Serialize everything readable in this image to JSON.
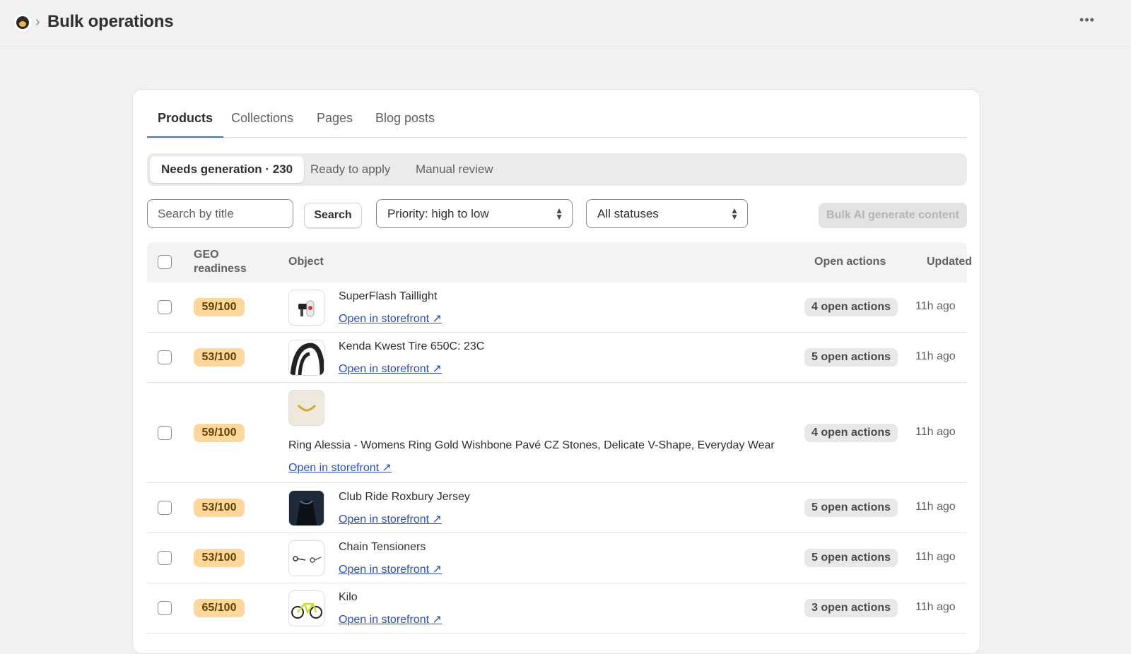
{
  "header": {
    "title": "Bulk operations",
    "breadcrumb_separator": "›",
    "more_label": "•••",
    "app_icon": "app-logo-icon"
  },
  "tabs": [
    {
      "label": "Products",
      "active": true
    },
    {
      "label": "Collections",
      "active": false
    },
    {
      "label": "Pages",
      "active": false
    },
    {
      "label": "Blog posts",
      "active": false
    }
  ],
  "segments": [
    {
      "label": "Needs generation · 230",
      "active": true
    },
    {
      "label": "Ready to apply",
      "active": false
    },
    {
      "label": "Manual review",
      "active": false
    }
  ],
  "filters": {
    "search_placeholder": "Search by title",
    "search_button": "Search",
    "sort_value": "Priority: high to low",
    "status_value": "All statuses",
    "bulk_button": "Bulk AI generate content",
    "bulk_disabled": true
  },
  "table": {
    "columns": {
      "geo_line1": "GEO",
      "geo_line2": "readiness",
      "object": "Object",
      "open_actions": "Open actions",
      "updated": "Updated"
    },
    "link_label": "Open in storefront ↗",
    "rows": [
      {
        "score": "59/100",
        "name": "SuperFlash Taillight",
        "actions": "4 open actions",
        "updated": "11h ago",
        "thumb": "taillight-thumb"
      },
      {
        "score": "53/100",
        "name": "Kenda Kwest Tire 650C: 23C",
        "actions": "5 open actions",
        "updated": "11h ago",
        "thumb": "tire-thumb"
      },
      {
        "score": "59/100",
        "name": "Ring Alessia - Womens Ring Gold Wishbone Pavé CZ Stones, Delicate V-Shape, Everyday Wear",
        "actions": "4 open actions",
        "updated": "11h ago",
        "thumb": "ring-thumb"
      },
      {
        "score": "53/100",
        "name": "Club Ride Roxbury Jersey",
        "actions": "5 open actions",
        "updated": "11h ago",
        "thumb": "jersey-thumb"
      },
      {
        "score": "53/100",
        "name": "Chain Tensioners",
        "actions": "5 open actions",
        "updated": "11h ago",
        "thumb": "chain-tensioner-thumb"
      },
      {
        "score": "65/100",
        "name": "Kilo",
        "actions": "3 open actions",
        "updated": "11h ago",
        "thumb": "bike-thumb"
      }
    ]
  },
  "colors": {
    "accent_tab": "#3d6fe0",
    "score_badge": "#ffd79d",
    "link": "#2c4fb0"
  }
}
